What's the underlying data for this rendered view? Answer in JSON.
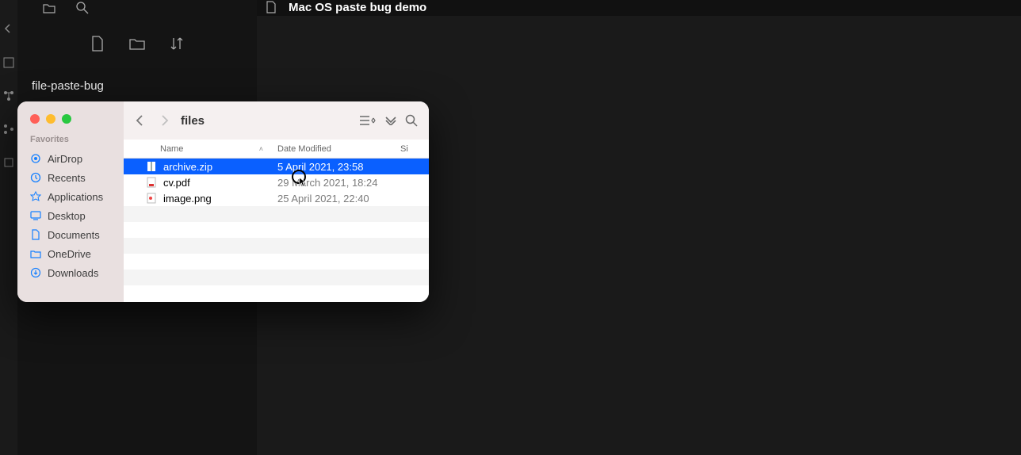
{
  "activity": {
    "icons": [
      "explorer",
      "search",
      "source-control",
      "debug",
      "extensions"
    ]
  },
  "sidebar": {
    "repo": "file-paste-bug",
    "commit_title": "Mac OS paste bug demo"
  },
  "editor": {
    "tab_title": "Mac OS paste bug demo"
  },
  "finder": {
    "title": "files",
    "favorites_header": "Favorites",
    "favorites": [
      {
        "label": "AirDrop",
        "icon": "airdrop-icon"
      },
      {
        "label": "Recents",
        "icon": "clock-icon"
      },
      {
        "label": "Applications",
        "icon": "apps-icon"
      },
      {
        "label": "Desktop",
        "icon": "desktop-icon"
      },
      {
        "label": "Documents",
        "icon": "documents-icon"
      },
      {
        "label": "OneDrive",
        "icon": "folder-icon"
      },
      {
        "label": "Downloads",
        "icon": "downloads-icon"
      }
    ],
    "columns": {
      "name": "Name",
      "date": "Date Modified",
      "size": "Si"
    },
    "files": [
      {
        "name": "archive.zip",
        "date": "5 April 2021, 23:58",
        "icon": "zip-file-icon",
        "selected": true
      },
      {
        "name": "cv.pdf",
        "date": "29 March 2021, 18:24",
        "icon": "pdf-file-icon",
        "selected": false
      },
      {
        "name": "image.png",
        "date": "25 April 2021, 22:40",
        "icon": "image-file-icon",
        "selected": false
      }
    ]
  }
}
